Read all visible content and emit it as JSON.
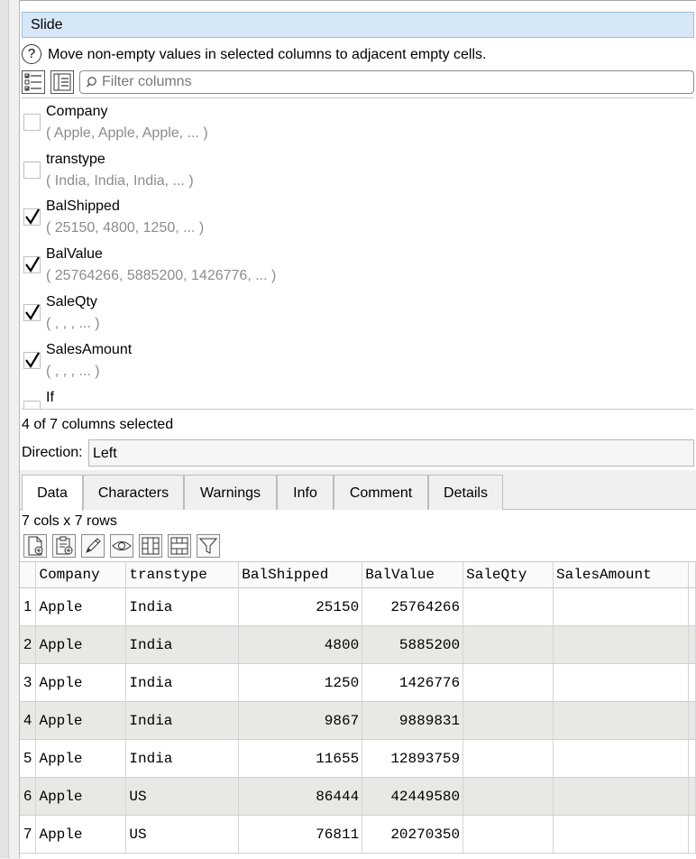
{
  "panel": {
    "title": "Slide",
    "help_text": "Move non-empty values in selected columns to adjacent empty cells.",
    "help_symbol": "?"
  },
  "filter": {
    "placeholder": "Filter columns"
  },
  "columns": [
    {
      "name": "Company",
      "sample": "( Apple, Apple, Apple, ... )",
      "checked": false,
      "selected": true
    },
    {
      "name": "transtype",
      "sample": "( India, India, India, ... )",
      "checked": false,
      "selected": false
    },
    {
      "name": "BalShipped",
      "sample": "( 25150, 4800, 1250, ... )",
      "checked": true,
      "selected": false
    },
    {
      "name": "BalValue",
      "sample": "( 25764266, 5885200, 1426776, ... )",
      "checked": true,
      "selected": false
    },
    {
      "name": "SaleQty",
      "sample": "( , , , ... )",
      "checked": true,
      "selected": false
    },
    {
      "name": "SalesAmount",
      "sample": "( , , , ... )",
      "checked": true,
      "selected": false
    },
    {
      "name": "If",
      "sample": "",
      "checked": false,
      "selected": false
    }
  ],
  "status": "4 of 7 columns selected",
  "direction": {
    "label": "Direction:",
    "value": "Left"
  },
  "tabs": [
    "Data",
    "Characters",
    "Warnings",
    "Info",
    "Comment",
    "Details"
  ],
  "active_tab": "Data",
  "grid": {
    "dims": "7 cols x 7 rows",
    "headers": [
      "Company",
      "transtype",
      "BalShipped",
      "BalValue",
      "SaleQty",
      "SalesAmount"
    ],
    "rows": [
      [
        "1",
        "Apple",
        "India",
        "25150",
        "25764266",
        "",
        ""
      ],
      [
        "2",
        "Apple",
        "India",
        "4800",
        "5885200",
        "",
        ""
      ],
      [
        "3",
        "Apple",
        "India",
        "1250",
        "1426776",
        "",
        ""
      ],
      [
        "4",
        "Apple",
        "India",
        "9867",
        "9889831",
        "",
        ""
      ],
      [
        "5",
        "Apple",
        "India",
        "11655",
        "12893759",
        "",
        ""
      ],
      [
        "6",
        "Apple",
        "US",
        "86444",
        "42449580",
        "",
        ""
      ],
      [
        "7",
        "Apple",
        "US",
        "76811",
        "20270350",
        "",
        ""
      ]
    ]
  },
  "icons": {
    "toolbar": [
      "checklist-icon",
      "list-icon"
    ],
    "grid_toolbar": [
      "new-file-icon",
      "paste-icon",
      "edit-pencil-icon",
      "eye-icon",
      "column-resize-icon",
      "row-resize-icon",
      "filter-icon"
    ]
  }
}
